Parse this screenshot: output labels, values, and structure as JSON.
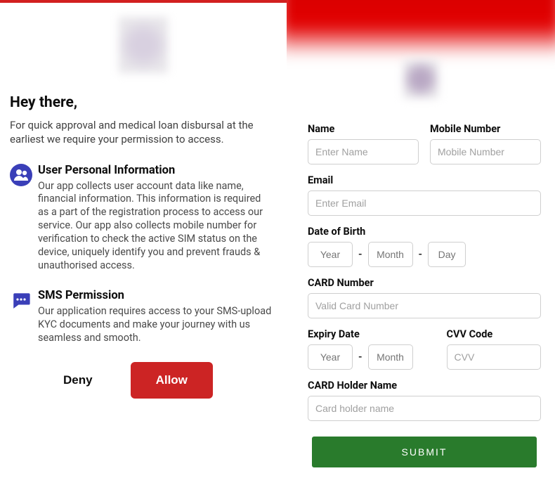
{
  "left": {
    "greeting": "Hey there,",
    "greeting_sub": "For quick approval and medical loan disbursal at the earliest we require your permission to access.",
    "permissions": {
      "user_info": {
        "title": "User Personal Information",
        "desc": "Our app collects user account data like name, financial information. This information is required as a part of the registration process to access our service. Our app also collects mobile number for verification to check the active SIM status on the device, uniquely identify you and prevent frauds & unauthorised access."
      },
      "sms": {
        "title": "SMS Permission",
        "desc": "Our application requires access to your SMS-upload KYC documents and make your journey with us seamless and smooth."
      }
    },
    "deny_label": "Deny",
    "allow_label": "Allow"
  },
  "right": {
    "labels": {
      "name": "Name",
      "mobile": "Mobile Number",
      "email": "Email",
      "dob": "Date of Birth",
      "card_number": "CARD Number",
      "expiry": "Expiry Date",
      "cvv": "CVV Code",
      "card_holder": "CARD Holder Name"
    },
    "placeholders": {
      "name": "Enter Name",
      "mobile": "Mobile Number",
      "email": "Enter Email",
      "year": "Year",
      "month": "Month",
      "day": "Day",
      "card_number": "Valid Card Number",
      "cvv": "CVV",
      "card_holder": "Card holder name"
    },
    "submit_label": "SUBMIT",
    "dob_sep": "-"
  }
}
